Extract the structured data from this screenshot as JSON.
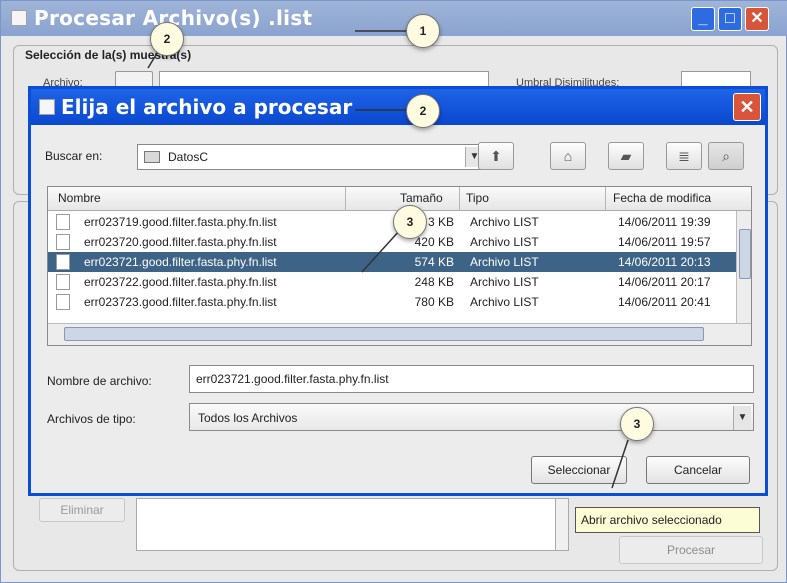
{
  "background_window": {
    "title": "Procesar Archivo(s)  .list",
    "group_title": "Selección de la(s) muestra(s)",
    "archivo_label": "Archivo:",
    "umbral_label": "Umbral Disimilitudes:",
    "eliminar_label": "Eliminar",
    "procesar_label": "Procesar",
    "tooltip": "Abrir archivo seleccionado"
  },
  "dialog": {
    "title": "Elija el archivo a procesar",
    "look_in_label": "Buscar en:",
    "look_in_value": "DatosC",
    "columns": [
      "Nombre",
      "Tamaño",
      "Tipo",
      "Fecha de modifica"
    ],
    "rows": [
      {
        "name": "err023719.good.filter.fasta.phy.fn.list",
        "size": "3  KB",
        "type": "Archivo LIST",
        "date": "14/06/2011 19:39",
        "selected": false
      },
      {
        "name": "err023720.good.filter.fasta.phy.fn.list",
        "size": "420 KB",
        "type": "Archivo LIST",
        "date": "14/06/2011 19:57",
        "selected": false
      },
      {
        "name": "err023721.good.filter.fasta.phy.fn.list",
        "size": "574 KB",
        "type": "Archivo LIST",
        "date": "14/06/2011 20:13",
        "selected": true
      },
      {
        "name": "err023722.good.filter.fasta.phy.fn.list",
        "size": "248 KB",
        "type": "Archivo LIST",
        "date": "14/06/2011 20:17",
        "selected": false
      },
      {
        "name": "err023723.good.filter.fasta.phy.fn.list",
        "size": "780 KB",
        "type": "Archivo LIST",
        "date": "14/06/2011 20:41",
        "selected": false
      }
    ],
    "file_name_label": "Nombre de archivo:",
    "file_name_value": "err023721.good.filter.fasta.phy.fn.list",
    "file_type_label": "Archivos de tipo:",
    "file_type_value": "Todos los Archivos",
    "select_button": "Seleccionar",
    "cancel_button": "Cancelar",
    "toolbar_icons": [
      "up-folder-icon",
      "home-icon",
      "new-folder-icon",
      "list-view-icon",
      "details-view-icon"
    ]
  },
  "callouts": [
    "1",
    "2",
    "2",
    "3",
    "3"
  ],
  "colors": {
    "dialog_title_bg": "#0a48cf",
    "background_title_bg": "#8aa3cf",
    "selected_row_bg": "#3d6386",
    "close_button": "#d9553a",
    "tooltip_bg": "#fcfcd5"
  }
}
